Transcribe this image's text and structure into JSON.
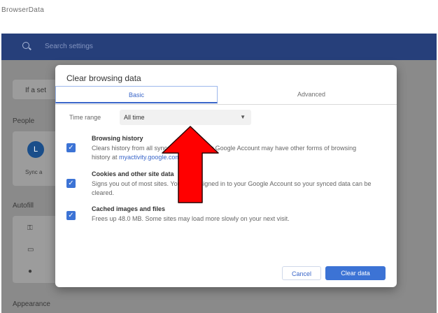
{
  "window": {
    "caption": "BrowserData"
  },
  "search": {
    "placeholder": "Search settings"
  },
  "background": {
    "notice_fragment": "If a set",
    "people_heading": "People",
    "avatar_letter": "L",
    "sync_fragment": "Sync a",
    "autofill_heading": "Autofill",
    "appearance_heading": "Appearance"
  },
  "dialog": {
    "title": "Clear browsing data",
    "tabs": {
      "basic": "Basic",
      "advanced": "Advanced"
    },
    "time_range": {
      "label": "Time range",
      "value": "All time"
    },
    "options": [
      {
        "title": "Browsing history",
        "desc_a": "Clears history from all synced devices. Your Google Account may have other forms of browsing history at ",
        "link": "myactivity.google.com",
        "desc_b": ".",
        "checked": true
      },
      {
        "title": "Cookies and other site data",
        "desc": "Signs you out of most sites. You'll stay signed in to your Google Account so your synced data can be cleared.",
        "checked": true
      },
      {
        "title": "Cached images and files",
        "desc": "Frees up 48.0 MB. Some sites may load more slowly on your next visit.",
        "checked": true
      }
    ],
    "buttons": {
      "cancel": "Cancel",
      "clear": "Clear data"
    }
  },
  "colors": {
    "accent": "#3c73d5",
    "header": "#263f7a",
    "arrow": "#ff0000"
  }
}
